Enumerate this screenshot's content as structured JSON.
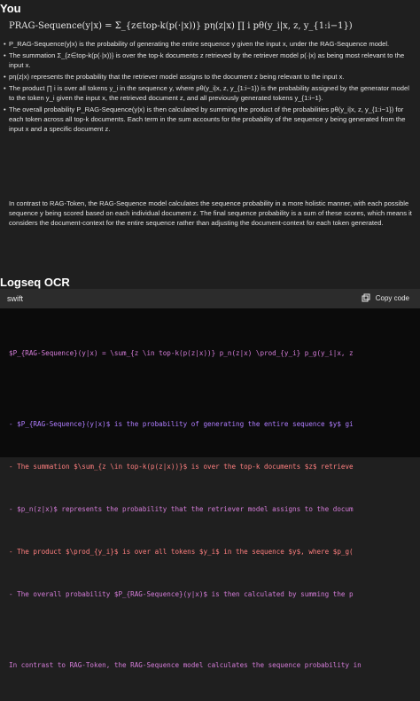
{
  "chat": {
    "speaker": "You",
    "formula": "PRAG-Sequence(y|x) = Σ_{z∈top-k(p(·|x))} pη(z|x) ∏ i pθ(y_i|x, z, y_{1:i−1})",
    "bullets": [
      "P_RAG-Sequence(y|x) is the probability of generating the entire sequence y given the input x, under the RAG-Sequence model.",
      "The summation Σ_{z∈top-k(p(·|x))} is over the top-k documents z retrieved by the retriever model p(·|x) as being most relevant to the input x.",
      "pη(z|x) represents the probability that the retriever model assigns to the document z being relevant to the input x.",
      "The product ∏ i is over all tokens y_i in the sequence y, where pθ(y_i|x, z, y_{1:i−1}) is the probability assigned by the generator model to the token y_i given the input x, the retrieved document z, and all previously generated tokens y_{1:i−1}.",
      "The overall probability P_RAG-Sequence(y|x) is then calculated by summing the product of the probabilities pθ(y_i|x, z, y_{1:i−1}) for each token across all top-k documents. Each term in the sum accounts for the probability of the sequence y being generated from the input x and a specific document z."
    ],
    "paragraph": "In contrast to RAG-Token, the RAG-Sequence model calculates the sequence probability in a more holistic manner, with each possible sequence y being scored based on each individual document z. The final sequence probability is a sum of these scores, which means it considers the document-context for the entire sequence rather than adjusting the document-context for each token generated."
  },
  "logseq_ocr": {
    "title": "Logseq OCR",
    "language": "swift",
    "copy_label": "Copy code",
    "code_lines": [
      "$P_{RAG-Sequence}(y|x) = \\sum_{z \\in top-k(p(z|x))} p_n(z|x) \\prod_{y_i} p_g(y_i|x, z",
      "",
      "- $P_{RAG-Sequence}(y|x)$ is the probability of generating the entire sequence $y$ gi",
      "- The summation $\\sum_{z \\in top-k(p(z|x))}$ is over the top-k documents $z$ retrieve",
      "- $p_n(z|x)$ represents the probability that the retriever model assigns to the docum",
      "- The product $\\prod_{y_i}$ is over all tokens $y_i$ in the sequence $y$, where $p_g(",
      "- The overall probability $P_{RAG-Sequence}(y|x)$ is then calculated by summing the p",
      "",
      "In contrast to RAG-Token, the RAG-Sequence model calculates the sequence probability in"
    ]
  }
}
